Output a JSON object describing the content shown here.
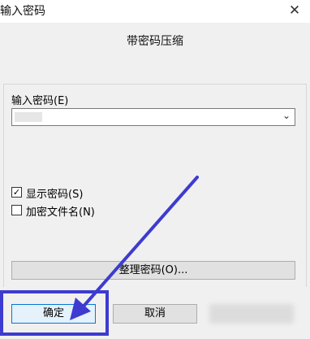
{
  "window": {
    "title": "输入密码",
    "close_glyph": "✕"
  },
  "header": {
    "tab_title": "带密码压缩"
  },
  "password": {
    "label": "输入密码(E)",
    "value": "●●●●●"
  },
  "options": {
    "show_password": {
      "label": "显示密码(S)",
      "checked": true
    },
    "encrypt_filenames": {
      "label": "加密文件名(N)",
      "checked": false
    }
  },
  "buttons": {
    "manage_password": "整理密码(O)...",
    "ok": "确定",
    "cancel": "取消"
  },
  "colors": {
    "annotation": "#3d3bd0",
    "focus_border": "#0078d7"
  }
}
